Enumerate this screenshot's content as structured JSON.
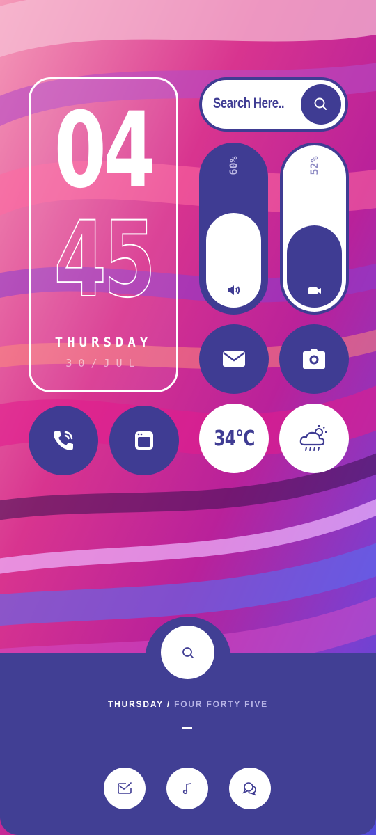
{
  "clock": {
    "hour": "04",
    "minute": "45",
    "day": "THURSDAY",
    "date": "30/JUL"
  },
  "search": {
    "placeholder": "Search Here.."
  },
  "sliders": {
    "volume_percent": "60%",
    "volume_level": 0.6,
    "brightness_percent": "52%",
    "brightness_level": 0.52
  },
  "weather": {
    "temperature": "34°C",
    "condition_icon": "cloud-rain-sun-icon"
  },
  "shortcuts": {
    "row1": [
      "mail-icon",
      "camera-icon"
    ],
    "row2": [
      "phone-icon",
      "browser-window-icon"
    ]
  },
  "dock": {
    "day": "THURSDAY",
    "separator": " / ",
    "time_words": "FOUR FORTY FIVE",
    "buttons": [
      "mail-edit-icon",
      "music-icon",
      "chat-icon"
    ]
  },
  "colors": {
    "accent": "#3f3c93",
    "white": "#ffffff"
  }
}
